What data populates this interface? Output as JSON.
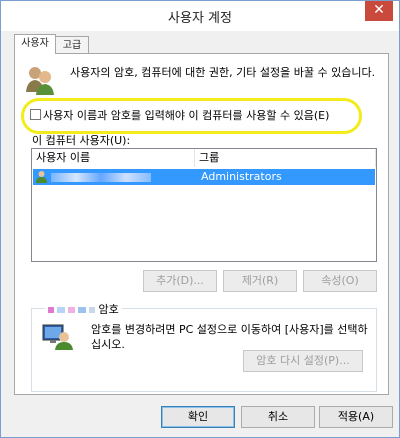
{
  "window": {
    "title": "사용자 계정",
    "close": "✕"
  },
  "tabs": [
    {
      "label": "사용자"
    },
    {
      "label": "고급"
    }
  ],
  "intro": {
    "text": "사용자의 암호, 컴퓨터에 대한 권한, 기타 설정을 바꿀 수 있습니다."
  },
  "require_password": {
    "label": "사용자 이름과 암호를 입력해야 이 컴퓨터를 사용할 수 있음(E)",
    "checked": false
  },
  "user_list": {
    "label": "이 컴퓨터 사용자(U):",
    "columns": [
      "사용자 이름",
      "그룹"
    ],
    "rows": [
      {
        "group": "Administrators",
        "selected": true
      }
    ]
  },
  "buttons": {
    "add": "추가(D)...",
    "remove": "제거(R)",
    "properties": "속성(O)"
  },
  "password_group": {
    "title_suffix": "암호",
    "text": "암호를 변경하려면 PC 설정으로 이동하여 [사용자]를 선택하십시오.",
    "reset_button": "암호 다시 설정(P)..."
  },
  "footer": {
    "ok": "확인",
    "cancel": "취소",
    "apply": "적용(A)"
  },
  "colors": {
    "selection": "#3399ff",
    "highlight_marker": "#f2ec1a",
    "close": "#c94a3c"
  }
}
